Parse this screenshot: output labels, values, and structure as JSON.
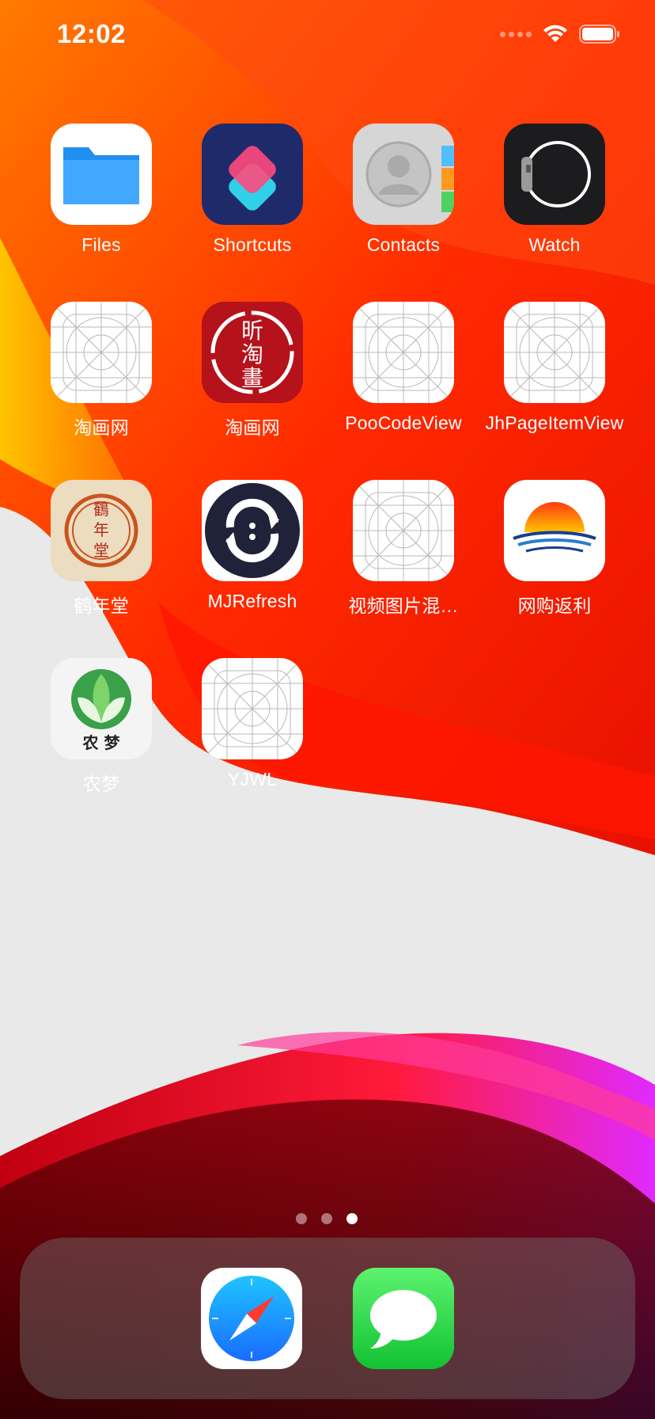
{
  "status_bar": {
    "time": "12:02",
    "signal_icon": "cellular-signal-icon",
    "wifi_icon": "wifi-icon",
    "battery_icon": "battery-icon"
  },
  "apps": [
    {
      "label": "Files",
      "icon": "files-folder-icon"
    },
    {
      "label": "Shortcuts",
      "icon": "shortcuts-icon"
    },
    {
      "label": "Contacts",
      "icon": "contacts-icon"
    },
    {
      "label": "Watch",
      "icon": "watch-icon"
    },
    {
      "label": "淘画网",
      "icon": "placeholder-app-icon"
    },
    {
      "label": "淘画网",
      "icon": "taohuawang-seal-icon"
    },
    {
      "label": "PooCodeView",
      "icon": "placeholder-app-icon"
    },
    {
      "label": "JhPageItemView",
      "icon": "placeholder-app-icon"
    },
    {
      "label": "鹤年堂",
      "icon": "henian-tang-logo-icon"
    },
    {
      "label": "MJRefresh",
      "icon": "mjrefresh-icon"
    },
    {
      "label": "视频图片混…",
      "icon": "placeholder-app-icon"
    },
    {
      "label": "网购返利",
      "icon": "sunrise-sea-icon"
    },
    {
      "label": "农梦",
      "icon": "nongmeng-leaf-icon"
    },
    {
      "label": "YJWL",
      "icon": "placeholder-app-icon"
    }
  ],
  "seal_text": {
    "t1": "昕",
    "t2": "淘",
    "t3": "畫"
  },
  "henian_text": {
    "t1": "鶴",
    "t2": "年",
    "t3": "堂"
  },
  "nongmeng_text": "农 梦",
  "page_dots": {
    "count": 3,
    "active_index": 2
  },
  "dock": [
    {
      "name": "Safari",
      "icon": "safari-compass-icon"
    },
    {
      "name": "Messages",
      "icon": "messages-bubble-icon"
    }
  ],
  "colors": {
    "wallpaper_red": "#ff2a00",
    "wallpaper_orange": "#ff6a00",
    "wallpaper_light": "#e9e9e9",
    "accent_magenta": "#e02aff"
  }
}
